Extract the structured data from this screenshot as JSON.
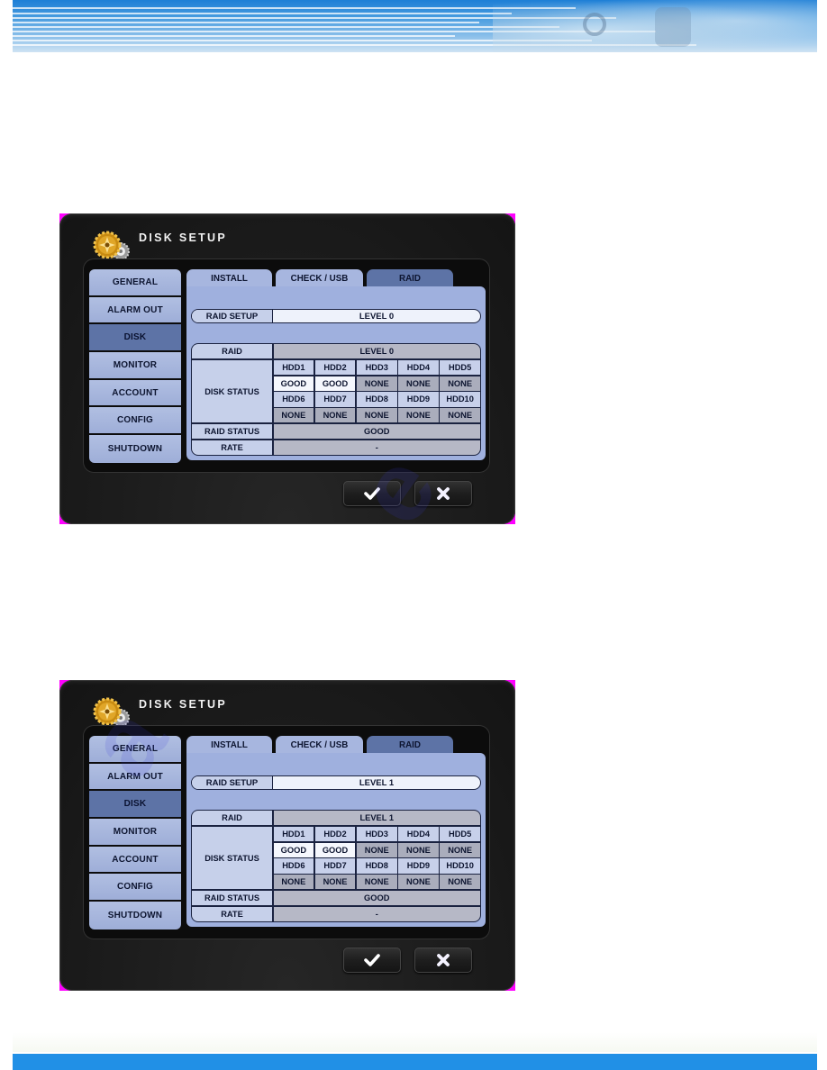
{
  "colors": {
    "banner_blue": "#1e7fd6",
    "footer_blue": "#2190e6",
    "menu_item": "#a7b6df",
    "menu_active": "#5d73a6",
    "dialog_bg": "#1b1b1b"
  },
  "dialogs": [
    {
      "title": "DISK SETUP",
      "menu": [
        "GENERAL",
        "ALARM OUT",
        "DISK",
        "MONITOR",
        "ACCOUNT",
        "CONFIG",
        "SHUTDOWN"
      ],
      "active_menu": "DISK",
      "tabs": [
        "INSTALL",
        "CHECK / USB",
        "RAID"
      ],
      "active_tab": "RAID",
      "raid_setup_label": "RAID SETUP",
      "raid_setup_value": "LEVEL 0",
      "table": {
        "raid_label": "RAID",
        "raid_value": "LEVEL 0",
        "disk_status_label": "DISK STATUS",
        "disks_row1": [
          "HDD1",
          "HDD2",
          "HDD3",
          "HDD4",
          "HDD5"
        ],
        "status_row1": [
          "GOOD",
          "GOOD",
          "NONE",
          "NONE",
          "NONE"
        ],
        "disks_row2": [
          "HDD6",
          "HDD7",
          "HDD8",
          "HDD9",
          "HDD10"
        ],
        "status_row2": [
          "NONE",
          "NONE",
          "NONE",
          "NONE",
          "NONE"
        ],
        "raid_status_label": "RAID STATUS",
        "raid_status_value": "GOOD",
        "rate_label": "RATE",
        "rate_value": "-"
      },
      "confirm_icon": "checkmark-icon",
      "cancel_icon": "close-icon"
    },
    {
      "title": "DISK SETUP",
      "menu": [
        "GENERAL",
        "ALARM OUT",
        "DISK",
        "MONITOR",
        "ACCOUNT",
        "CONFIG",
        "SHUTDOWN"
      ],
      "active_menu": "DISK",
      "tabs": [
        "INSTALL",
        "CHECK / USB",
        "RAID"
      ],
      "active_tab": "RAID",
      "raid_setup_label": "RAID SETUP",
      "raid_setup_value": "LEVEL 1",
      "table": {
        "raid_label": "RAID",
        "raid_value": "LEVEL 1",
        "disk_status_label": "DISK STATUS",
        "disks_row1": [
          "HDD1",
          "HDD2",
          "HDD3",
          "HDD4",
          "HDD5"
        ],
        "status_row1": [
          "GOOD",
          "GOOD",
          "NONE",
          "NONE",
          "NONE"
        ],
        "disks_row2": [
          "HDD6",
          "HDD7",
          "HDD8",
          "HDD9",
          "HDD10"
        ],
        "status_row2": [
          "NONE",
          "NONE",
          "NONE",
          "NONE",
          "NONE"
        ],
        "raid_status_label": "RAID STATUS",
        "raid_status_value": "GOOD",
        "rate_label": "RATE",
        "rate_value": "-"
      },
      "confirm_icon": "checkmark-icon",
      "cancel_icon": "close-icon"
    }
  ]
}
